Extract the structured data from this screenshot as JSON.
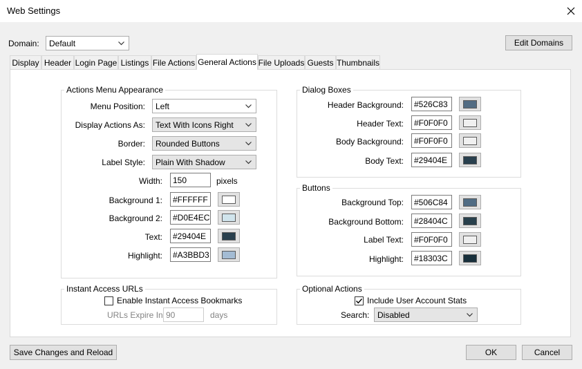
{
  "window": {
    "title": "Web Settings"
  },
  "domain": {
    "label": "Domain:",
    "value": "Default",
    "edit_button": "Edit Domains"
  },
  "tabs": [
    {
      "label": "Display"
    },
    {
      "label": "Header"
    },
    {
      "label": "Login Page"
    },
    {
      "label": "Listings"
    },
    {
      "label": "File Actions"
    },
    {
      "label": "General Actions"
    },
    {
      "label": "File Uploads"
    },
    {
      "label": "Guests"
    },
    {
      "label": "Thumbnails"
    }
  ],
  "actions_menu": {
    "title": "Actions Menu Appearance",
    "menu_position": {
      "label": "Menu Position:",
      "value": "Left"
    },
    "display_as": {
      "label": "Display Actions As:",
      "value": "Text With Icons Right"
    },
    "border": {
      "label": "Border:",
      "value": "Rounded Buttons"
    },
    "label_style": {
      "label": "Label Style:",
      "value": "Plain With Shadow"
    },
    "width": {
      "label": "Width:",
      "value": "150",
      "unit": "pixels"
    },
    "background1": {
      "label": "Background 1:",
      "value": "#FFFFFF",
      "color": "#ffffff"
    },
    "background2": {
      "label": "Background 2:",
      "value": "#D0E4EC",
      "color": "#d0e4ec"
    },
    "text": {
      "label": "Text:",
      "value": "#29404E",
      "color": "#29404e"
    },
    "highlight": {
      "label": "Highlight:",
      "value": "#A3BBD3",
      "color": "#a3bbd3"
    }
  },
  "instant_access": {
    "title": "Instant Access URLs",
    "enable_label": "Enable Instant Access Bookmarks",
    "expire_label": "URLs Expire In",
    "expire_value": "90",
    "expire_unit": "days"
  },
  "dialog_boxes": {
    "title": "Dialog Boxes",
    "header_bg": {
      "label": "Header Background:",
      "value": "#526C83",
      "color": "#526c83"
    },
    "header_text": {
      "label": "Header Text:",
      "value": "#F0F0F0",
      "color": "#f0f0f0"
    },
    "body_bg": {
      "label": "Body Background:",
      "value": "#F0F0F0",
      "color": "#f0f0f0"
    },
    "body_text": {
      "label": "Body Text:",
      "value": "#29404E",
      "color": "#29404e"
    }
  },
  "buttons": {
    "title": "Buttons",
    "bg_top": {
      "label": "Background Top:",
      "value": "#506C84",
      "color": "#506c84"
    },
    "bg_bottom": {
      "label": "Background Bottom:",
      "value": "#28404C",
      "color": "#28404c"
    },
    "label_text": {
      "label": "Label Text:",
      "value": "#F0F0F0",
      "color": "#f0f0f0"
    },
    "highlight": {
      "label": "Highlight:",
      "value": "#18303C",
      "color": "#18303c"
    }
  },
  "optional_actions": {
    "title": "Optional Actions",
    "include_stats_label": "Include User Account Stats",
    "search_label": "Search:",
    "search_value": "Disabled"
  },
  "footer": {
    "save_reload": "Save Changes and Reload",
    "ok": "OK",
    "cancel": "Cancel"
  }
}
